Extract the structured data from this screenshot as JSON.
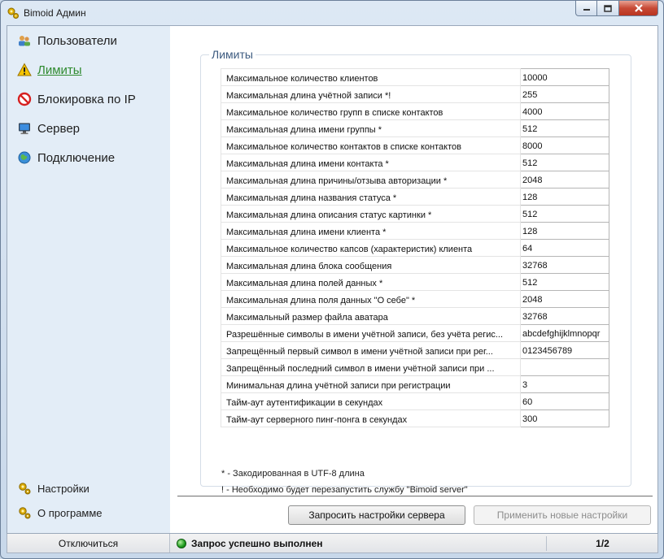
{
  "window": {
    "title": "Bimoid Админ"
  },
  "sidebar": {
    "items": [
      {
        "label": "Пользователи",
        "icon": "users-icon"
      },
      {
        "label": "Лимиты",
        "icon": "warning-icon",
        "active": true
      },
      {
        "label": "Блокировка по IP",
        "icon": "blocked-icon"
      },
      {
        "label": "Сервер",
        "icon": "monitor-icon"
      },
      {
        "label": "Подключение",
        "icon": "globe-icon"
      }
    ],
    "bottom_items": [
      {
        "label": "Настройки",
        "icon": "gears-icon"
      },
      {
        "label": "О программе",
        "icon": "gears-icon"
      }
    ]
  },
  "limits": {
    "title": "Лимиты",
    "rows": [
      {
        "label": "Максимальное количество клиентов",
        "value": "10000"
      },
      {
        "label": "Максимальная длина учётной записи *!",
        "value": "255"
      },
      {
        "label": "Максимальное количество групп в списке контактов",
        "value": "4000"
      },
      {
        "label": "Максимальная длина имени группы *",
        "value": "512"
      },
      {
        "label": "Максимальное количество контактов в списке контактов",
        "value": "8000"
      },
      {
        "label": "Максимальная длина имени контакта *",
        "value": "512"
      },
      {
        "label": "Максимальная длина причины/отзыва авторизации *",
        "value": "2048"
      },
      {
        "label": "Максимальная длина названия статуса *",
        "value": "128"
      },
      {
        "label": "Максимальная длина описания статус картинки *",
        "value": "512"
      },
      {
        "label": "Максимальная длина имени клиента *",
        "value": "128"
      },
      {
        "label": "Максимальное количество капсов (характеристик) клиента",
        "value": "64"
      },
      {
        "label": "Максимальная длина блока сообщения",
        "value": "32768"
      },
      {
        "label": "Максимальная длина полей данных *",
        "value": "512"
      },
      {
        "label": "Максимальная длина поля данных \"О себе\" *",
        "value": "2048"
      },
      {
        "label": "Максимальный размер файла аватара",
        "value": "32768"
      },
      {
        "label": "Разрешённые символы в имени учётной записи, без учёта регис...",
        "value": "abcdefghijklmnopqr"
      },
      {
        "label": "Запрещённый первый символ в имени учётной записи при рег...",
        "value": "0123456789"
      },
      {
        "label": "Запрещённый последний символ в имени учётной записи при ...",
        "value": ""
      },
      {
        "label": "Минимальная длина учётной записи при регистрации",
        "value": "3"
      },
      {
        "label": "Тайм-аут аутентификации в секундах",
        "value": "60"
      },
      {
        "label": "Тайм-аут серверного пинг-понга в секундах",
        "value": "300"
      }
    ],
    "notes": [
      "* - Закодированная в UTF-8 длина",
      "! - Необходимо будет перезапустить службу \"Bimoid server\""
    ]
  },
  "buttons": {
    "request": "Запросить настройки сервера",
    "apply": "Применить новые настройки"
  },
  "status": {
    "disconnect": "Отключиться",
    "message": "Запрос успешно выполнен",
    "page": "1/2"
  }
}
